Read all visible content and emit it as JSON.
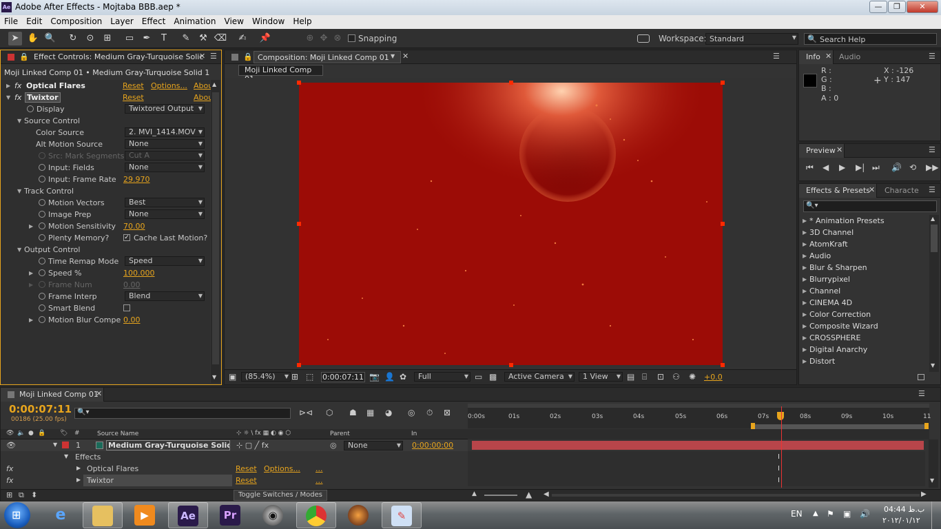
{
  "window": {
    "title": "Adobe After Effects - Mojtaba BBB.aep *",
    "app_icon": "Ae",
    "minimize": "—",
    "maximize": "❐",
    "close": "✕"
  },
  "menu": [
    "File",
    "Edit",
    "Composition",
    "Layer",
    "Effect",
    "Animation",
    "View",
    "Window",
    "Help"
  ],
  "toolbar": {
    "snapping": "Snapping",
    "workspace_label": "Workspace:",
    "workspace_value": "Standard",
    "search_placeholder": "Search Help"
  },
  "effect_controls": {
    "tab": "Effect Controls: Medium Gray-Turquoise Solic",
    "subtitle": "Moji Linked Comp 01 • Medium Gray-Turquoise Solid 1",
    "optical_flares": {
      "name": "Optical Flares",
      "reset": "Reset",
      "options": "Options...",
      "about": "Abou"
    },
    "twixtor": {
      "name": "Twixtor",
      "reset": "Reset",
      "about": "Abou"
    },
    "rows": {
      "display": "Display",
      "display_val": "Twixtored Output",
      "source_control": "Source Control",
      "color_source": "Color Source",
      "color_source_val": "2. MVI_1414.MOV",
      "alt_motion": "Alt Motion Source",
      "alt_motion_val": "None",
      "src_mark": "Src: Mark Segments",
      "src_mark_val": "Cut A",
      "input_fields": "Input: Fields",
      "input_fields_val": "None",
      "input_rate": "Input: Frame Rate",
      "input_rate_val": "29.970",
      "track_control": "Track Control",
      "motion_vectors": "Motion Vectors",
      "motion_vectors_val": "Best",
      "image_prep": "Image Prep",
      "image_prep_val": "None",
      "motion_sens": "Motion Sensitivity",
      "motion_sens_val": "70.00",
      "plenty_mem": "Plenty Memory?",
      "cache_last": "Cache Last Motion?",
      "output_control": "Output Control",
      "time_remap": "Time Remap Mode",
      "time_remap_val": "Speed",
      "speed": "Speed %",
      "speed_val": "100.000",
      "frame_num": "Frame Num",
      "frame_num_val": "0.00",
      "frame_interp": "Frame Interp",
      "frame_interp_val": "Blend",
      "smart_blend": "Smart Blend",
      "motion_blur": "Motion Blur Compe",
      "motion_blur_val": "0.00"
    }
  },
  "composition": {
    "tab": "Composition: Moji Linked Comp 01",
    "breadcrumb": "Moji Linked Comp 01",
    "zoom": "(85.4%)",
    "timecode": "0:00:07:11",
    "resolution": "Full",
    "camera": "Active Camera",
    "view": "1 View",
    "exposure": "+0.0"
  },
  "info": {
    "tab": "Info",
    "tab2": "Audio",
    "r": "R :",
    "g": "G :",
    "b": "B :",
    "a": "A : 0",
    "x": "X : -126",
    "y": "Y : 147"
  },
  "preview": {
    "tab": "Preview"
  },
  "effects_presets": {
    "tab": "Effects & Presets",
    "tab2": "Characte",
    "items": [
      "* Animation Presets",
      "3D Channel",
      "AtomKraft",
      "Audio",
      "Blur & Sharpen",
      "Blurrypixel",
      "Channel",
      "CINEMA 4D",
      "Color Correction",
      "Composite Wizard",
      "CROSSPHERE",
      "Digital Anarchy",
      "Distort"
    ]
  },
  "timeline": {
    "tab": "Moji Linked Comp 01",
    "timecode": "0:00:07:11",
    "frames": "00186 (25.00 fps)",
    "col_source": "Source Name",
    "col_parent": "Parent",
    "col_in": "In",
    "ruler": [
      "0:00s",
      "01s",
      "02s",
      "03s",
      "04s",
      "05s",
      "06s",
      "07s",
      "08s",
      "09s",
      "10s",
      "11"
    ],
    "layer_num": "1",
    "layer_name": "Medium Gray-Turquoise Solid 1",
    "parent_val": "None",
    "in_val": "0:00:00:00",
    "effects_label": "Effects",
    "fx1": "Optical Flares",
    "fx2": "Twixtor",
    "reset": "Reset",
    "options": "Options...",
    "dots": "...",
    "toggle": "Toggle Switches / Modes"
  },
  "taskbar": {
    "lang": "EN",
    "time": "04:44 ب.ظ",
    "date": "۲۰۱۲/۰۱/۱۲"
  },
  "colors": {
    "viewer_red": "#9c0c06",
    "accent_orange": "#e8a51d",
    "layer_bar": "#b8454a"
  }
}
